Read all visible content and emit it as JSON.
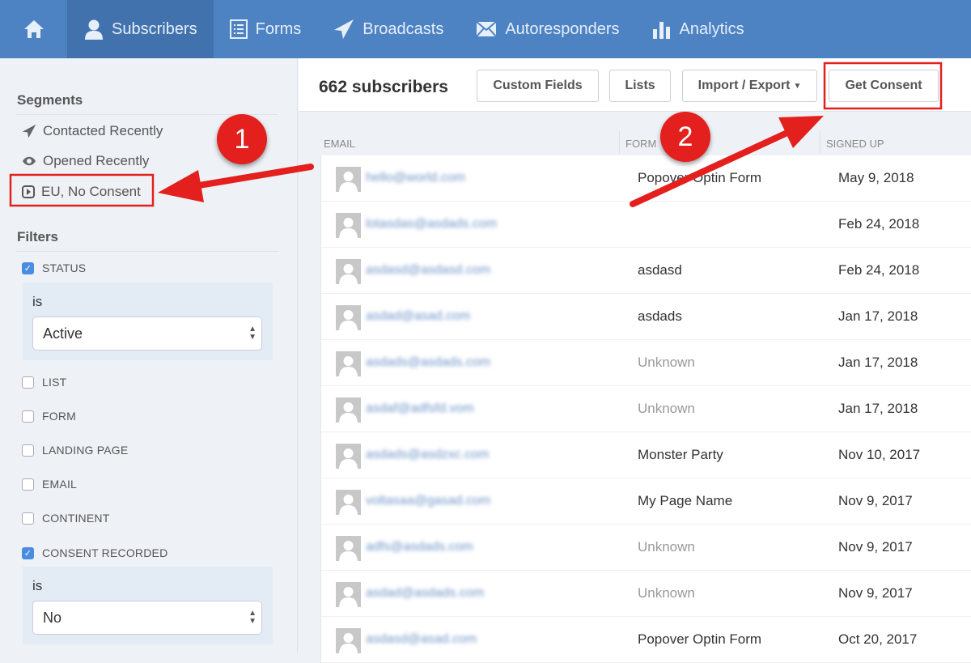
{
  "nav": {
    "home_icon": "home-icon",
    "tabs": [
      {
        "label": "Subscribers",
        "icon": "user-icon",
        "active": true
      },
      {
        "label": "Forms",
        "icon": "list-icon"
      },
      {
        "label": "Broadcasts",
        "icon": "paper-plane-icon"
      },
      {
        "label": "Autoresponders",
        "icon": "envelope-icon"
      },
      {
        "label": "Analytics",
        "icon": "bar-chart-icon"
      }
    ]
  },
  "sidebar": {
    "segments_title": "Segments",
    "segments": [
      {
        "label": "Contacted Recently",
        "icon": "paper-plane-icon"
      },
      {
        "label": "Opened Recently",
        "icon": "eye-icon"
      },
      {
        "label": "EU, No Consent",
        "icon": "play-box-icon"
      }
    ],
    "filters_title": "Filters",
    "filters": [
      {
        "label": "STATUS",
        "checked": true
      },
      {
        "label": "LIST",
        "checked": false
      },
      {
        "label": "FORM",
        "checked": false
      },
      {
        "label": "LANDING PAGE",
        "checked": false
      },
      {
        "label": "EMAIL",
        "checked": false
      },
      {
        "label": "CONTINENT",
        "checked": false
      },
      {
        "label": "CONSENT RECORDED",
        "checked": true
      }
    ],
    "status_filter": {
      "operator": "is",
      "value": "Active"
    },
    "consent_filter": {
      "operator": "is",
      "value": "No"
    }
  },
  "main": {
    "count": "662 subscribers",
    "buttons": {
      "custom_fields": "Custom Fields",
      "lists": "Lists",
      "import_export": "Import / Export",
      "get_consent": "Get Consent"
    },
    "columns": [
      "EMAIL",
      "FORM",
      "SIGNED UP"
    ],
    "rows": [
      {
        "email": "hello@world.com",
        "form": "Popover Optin Form",
        "date": "May 9, 2018"
      },
      {
        "email": "lotasdas@asdads.com",
        "form": "",
        "date": "Feb 24, 2018"
      },
      {
        "email": "asdasd@asdasd.com",
        "form": "asdasd",
        "date": "Feb 24, 2018"
      },
      {
        "email": "asdad@asad.com",
        "form": "asdads",
        "date": "Jan 17, 2018"
      },
      {
        "email": "asdads@asdads.com",
        "form": "Unknown",
        "date": "Jan 17, 2018"
      },
      {
        "email": "asdaf@adfsfd.vom",
        "form": "Unknown",
        "date": "Jan 17, 2018"
      },
      {
        "email": "asdads@asdzxc.com",
        "form": "Monster Party",
        "date": "Nov 10, 2017"
      },
      {
        "email": "voltasaa@gasad.com",
        "form": "My Page Name",
        "date": "Nov 9, 2017"
      },
      {
        "email": "adfs@asdads.com",
        "form": "Unknown",
        "date": "Nov 9, 2017"
      },
      {
        "email": "asdad@asdads.com",
        "form": "Unknown",
        "date": "Nov 9, 2017"
      },
      {
        "email": "asdasd@asad.com",
        "form": "Popover Optin Form",
        "date": "Oct 20, 2017"
      }
    ]
  },
  "annotations": {
    "step1": "1",
    "step2": "2",
    "color": "#e3201d"
  }
}
